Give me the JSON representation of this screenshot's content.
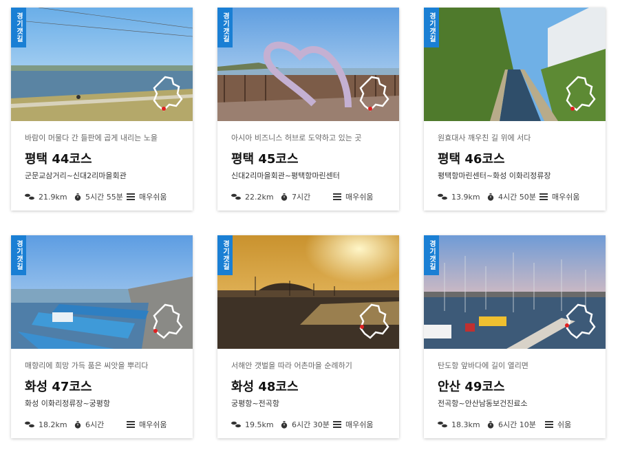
{
  "colors": {
    "tag_bg": "#1a7fd4",
    "marker": "#e02020"
  },
  "cards": [
    {
      "tag": "경기갯길",
      "subtitle": "바람이 머물다 간 들판에 곱게 내리는 노을",
      "title": "평택 44코스",
      "route": "군문교삼거리~신대2리마을회관",
      "distance": "21.9km",
      "duration": "5시간 55분",
      "difficulty": "매우쉬움",
      "icons": [
        "footprints-icon",
        "stopwatch-icon",
        "difficulty-bars-icon"
      ]
    },
    {
      "tag": "경기갯길",
      "subtitle": "아시아 비즈니스 허브로 도약하고 있는 곳",
      "title": "평택 45코스",
      "route": "신대2리마을회관~평택항마린센터",
      "distance": "22.2km",
      "duration": "7시간",
      "difficulty": "매우쉬움",
      "icons": [
        "footprints-icon",
        "stopwatch-icon",
        "difficulty-bars-icon"
      ]
    },
    {
      "tag": "경기갯길",
      "subtitle": "원효대사 깨우친 길 위에 서다",
      "title": "평택 46코스",
      "route": "평택항마린센터~화성 이화리정류장",
      "distance": "13.9km",
      "duration": "4시간 50분",
      "difficulty": "매우쉬움",
      "icons": [
        "footprints-icon",
        "stopwatch-icon",
        "difficulty-bars-icon"
      ]
    },
    {
      "tag": "경기갯길",
      "subtitle": "매향리에 희망 가득 품은 씨앗을 뿌리다",
      "title": "화성 47코스",
      "route": "화성 이화리정류장~궁평항",
      "distance": "18.2km",
      "duration": "6시간",
      "difficulty": "매우쉬움",
      "icons": [
        "footprints-icon",
        "stopwatch-icon",
        "difficulty-bars-icon"
      ]
    },
    {
      "tag": "경기갯길",
      "subtitle": "서해안 갯벌을 따라 어촌마을 순례하기",
      "title": "화성 48코스",
      "route": "궁평항~전곡항",
      "distance": "19.5km",
      "duration": "6시간 30분",
      "difficulty": "매우쉬움",
      "icons": [
        "footprints-icon",
        "stopwatch-icon",
        "difficulty-bars-icon"
      ]
    },
    {
      "tag": "경기갯길",
      "subtitle": "탄도항 앞바다에 길이 열리면",
      "title": "안산 49코스",
      "route": "전곡항~안산남동보건진료소",
      "distance": "18.3km",
      "duration": "6시간 10분",
      "difficulty": "쉬움",
      "icons": [
        "footprints-icon",
        "stopwatch-icon",
        "difficulty-bars-icon"
      ]
    }
  ]
}
